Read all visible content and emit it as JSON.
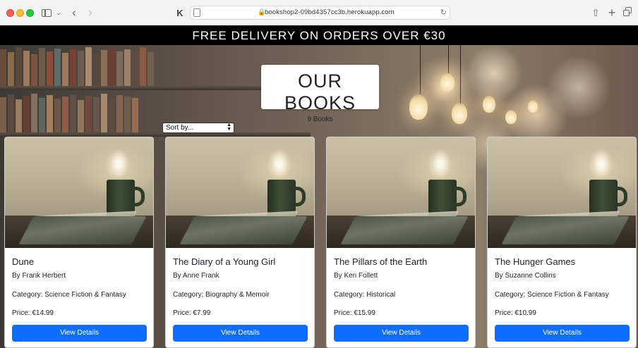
{
  "browser": {
    "url": "bookshop2-09bd4357cc3b.herokuapp.com"
  },
  "banner": {
    "text": "FREE DELIVERY ON ORDERS OVER €30"
  },
  "header": {
    "title": "OUR BOOKS",
    "count": "9 Books"
  },
  "sort": {
    "selected": "Sort by..."
  },
  "books": [
    {
      "title": "Dune",
      "author": "By Frank Herbert",
      "category": "Category: Science Fiction & Fantasy",
      "price": "Price: €14.99",
      "button": "View Details"
    },
    {
      "title": "The Diary of a Young Girl",
      "author": "By Anne Frank",
      "category": "Category: Biography & Memoir",
      "price": "Price: €7.99",
      "button": "View Details"
    },
    {
      "title": "The Pillars of the Earth",
      "author": "By Ken Follett",
      "category": "Category: Historical",
      "price": "Price: €15.99",
      "button": "View Details"
    },
    {
      "title": "The Hunger Games",
      "author": "By Suzanne Collins",
      "category": "Category: Science Fiction & Fantasy",
      "price": "Price: €10.99",
      "button": "View Details"
    }
  ],
  "colors": {
    "primary": "#0d6efd",
    "banner_bg": "#000000"
  }
}
